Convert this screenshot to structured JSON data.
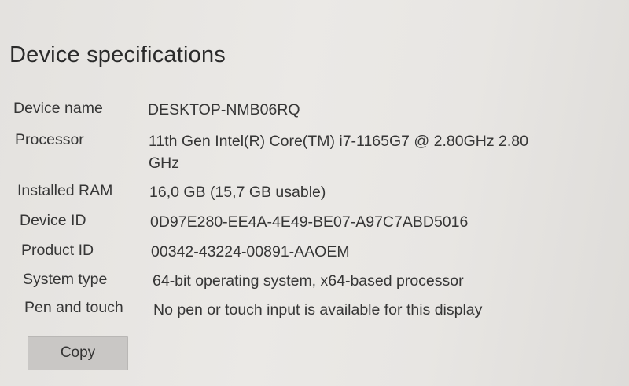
{
  "section": {
    "title": "Device specifications"
  },
  "specs": [
    {
      "label": "Device name",
      "value": "DESKTOP-NMB06RQ"
    },
    {
      "label": "Processor",
      "value": "11th Gen Intel(R) Core(TM) i7-1165G7 @ 2.80GHz   2.80 GHz"
    },
    {
      "label": "Installed RAM",
      "value": "16,0 GB (15,7 GB usable)"
    },
    {
      "label": "Device ID",
      "value": "0D97E280-EE4A-4E49-BE07-A97C7ABD5016"
    },
    {
      "label": "Product ID",
      "value": "00342-43224-00891-AAOEM"
    },
    {
      "label": "System type",
      "value": "64-bit operating system, x64-based processor"
    },
    {
      "label": "Pen and touch",
      "value": "No pen or touch input is available for this display"
    }
  ],
  "actions": {
    "copy_label": "Copy"
  }
}
